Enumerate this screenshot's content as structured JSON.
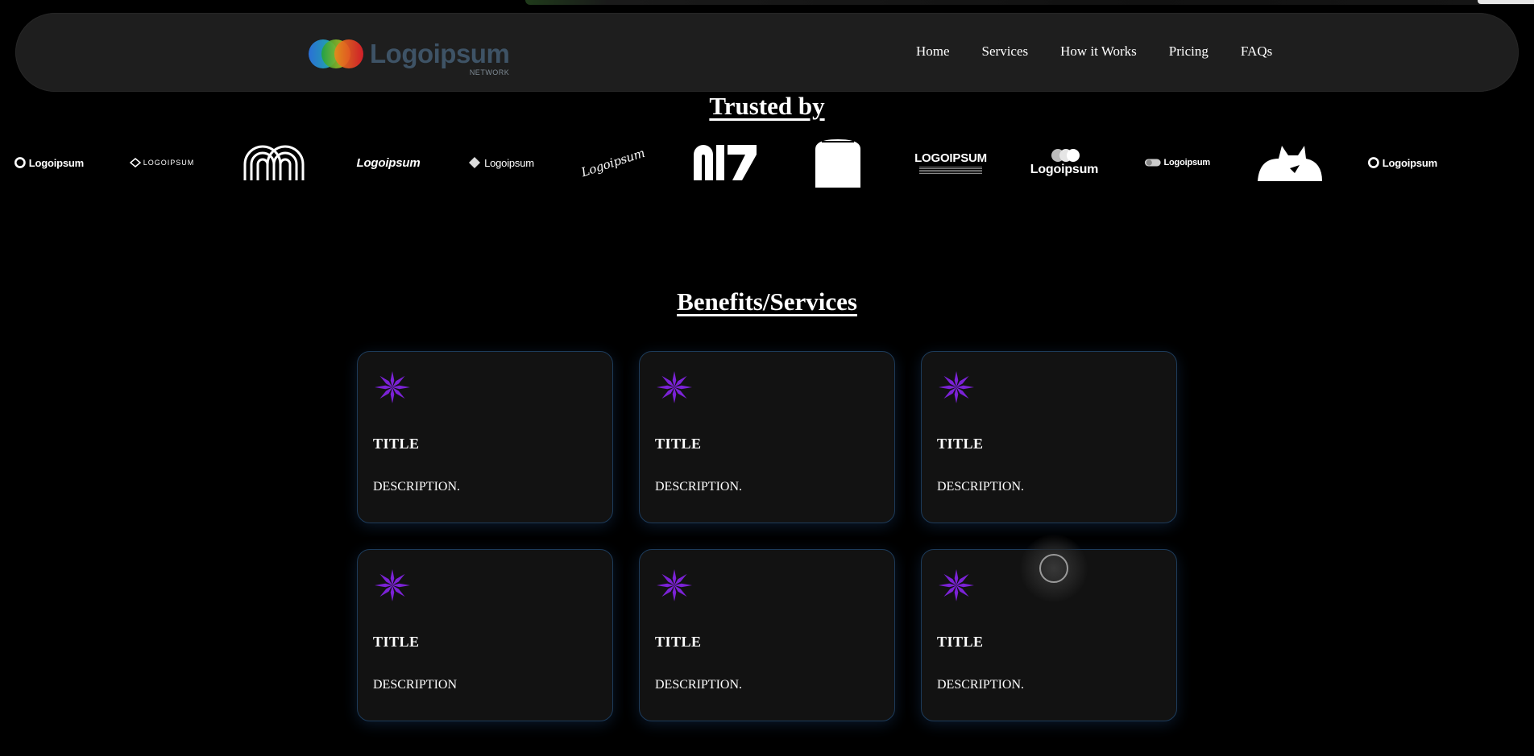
{
  "nav": {
    "brand_name": "Logoipsum",
    "brand_sub": "NETWORK",
    "links": [
      "Home",
      "Services",
      "How it Works",
      "Pricing",
      "FAQs"
    ]
  },
  "trusted": {
    "title": "Trusted by",
    "logos": [
      {
        "icon": "ring-logo-icon",
        "label": "Logoipsum"
      },
      {
        "icon": "diamond-outline-logo-icon",
        "label": "LOGOIPSUM"
      },
      {
        "icon": "concentric-loops-logo-icon",
        "label": ""
      },
      {
        "icon": "wordmark-logo-icon",
        "label": "Logoipsum"
      },
      {
        "icon": "diamond-logo-icon",
        "label": "Logoipsum"
      },
      {
        "icon": "script-signature-logo-icon",
        "label": "Logoipsum"
      },
      {
        "icon": "block-letters-logo-icon",
        "label": ""
      },
      {
        "icon": "arch-block-logo-icon",
        "label": ""
      },
      {
        "icon": "stacked-wordmark-logo-icon",
        "label": "LOGOIPSUM"
      },
      {
        "icon": "bubbles-logo-icon",
        "label": "Logoipsum"
      },
      {
        "icon": "pill-logo-icon",
        "label": "Logoipsum"
      },
      {
        "icon": "cat-silhouette-logo-icon",
        "label": ""
      },
      {
        "icon": "ring-logo-icon",
        "label": "Logoipsum"
      }
    ]
  },
  "benefits": {
    "title": "Benefits/Services",
    "cards": [
      {
        "title": "TITLE",
        "description": "DESCRIPTION."
      },
      {
        "title": "TITLE",
        "description": "DESCRIPTION."
      },
      {
        "title": "TITLE",
        "description": "DESCRIPTION."
      },
      {
        "title": "TITLE",
        "description": "DESCRIPTION"
      },
      {
        "title": "TITLE",
        "description": "DESCRIPTION."
      },
      {
        "title": "TITLE",
        "description": "DESCRIPTION."
      }
    ],
    "icon": "star-flower-icon",
    "icon_color": "#7b22d6"
  },
  "colors": {
    "background": "#000000",
    "navbar": "#1e1e1e",
    "card": "#121212",
    "card_border": "#1d3b5a",
    "brand_text": "#3e5366"
  }
}
